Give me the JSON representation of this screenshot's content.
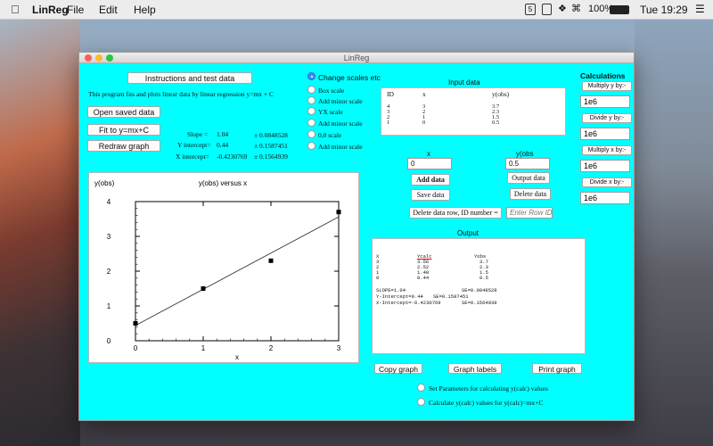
{
  "menubar": {
    "app_name": "LinReg",
    "menus": [
      "File",
      "Edit",
      "Help"
    ],
    "status": {
      "calendar": "5",
      "battery": "100%",
      "clock": "Tue 19:29"
    }
  },
  "window": {
    "title": "LinReg"
  },
  "left": {
    "instructions_button": "Instructions and test data",
    "description": "This program fits and plots linear data by linear regression y=mx + C",
    "open_button": "Open saved data",
    "fit_button": "Fit to y=mx+C",
    "redraw_button": "Redraw graph",
    "stats": {
      "slope_label": "Slope =",
      "slope_value": "1.04",
      "slope_se": "± 0.0848528",
      "yint_label": "Y intercept=",
      "yint_value": "0.44",
      "yint_se": "± 0.1587451",
      "xint_label": "X intercept=",
      "xint_value": "-0.4230769",
      "xint_se": "± 0.1564939"
    }
  },
  "scale_options": [
    {
      "label": "Change scales etc",
      "selected": true
    },
    {
      "label": "Box scale",
      "selected": false
    },
    {
      "label": "Add minor scale",
      "selected": false
    },
    {
      "label": "YX scale",
      "selected": false
    },
    {
      "label": "Add minor scale",
      "selected": false
    },
    {
      "label": "0,0 scale",
      "selected": false
    },
    {
      "label": "Add minor scale",
      "selected": false
    }
  ],
  "input": {
    "title": "Input data",
    "headers": [
      "ID",
      "x",
      "y(obs)"
    ],
    "rows": [
      [
        "4",
        "3",
        "3.7"
      ],
      [
        "3",
        "2",
        "2.3"
      ],
      [
        "2",
        "1",
        "1.5"
      ],
      [
        "1",
        "0",
        "0.5"
      ]
    ],
    "x_label": "x",
    "y_label": "y(obs",
    "x_value": "0",
    "y_value": "0.5",
    "add_button": "Add data",
    "output_data_button": "Output data",
    "save_button": "Save data",
    "delete_button": "Delete data",
    "delete_row_button": "Delete data row, ID number =",
    "row_id_placeholder": "Enter Row ID"
  },
  "output": {
    "title": "Output",
    "headers": [
      "X",
      "Ycalc",
      "Yobs"
    ],
    "rows": [
      [
        "3",
        "3.56",
        "3.7"
      ],
      [
        "2",
        "2.52",
        "2.3"
      ],
      [
        "1",
        "1.48",
        "1.5"
      ],
      [
        "0",
        "0.44",
        "0.5"
      ]
    ],
    "stats": [
      [
        "SLOPE=1.04",
        "SE=0.0848528"
      ],
      [
        "Y-Intercept=0.44",
        "SE=0.1587451"
      ],
      [
        "X-Intercept=-0.4230769",
        "SE=0.1564939"
      ]
    ],
    "copy_button": "Copy graph",
    "labels_button": "Graph labels",
    "print_button": "Print graph",
    "radio1": "Set Parameters for calculating y(calc) values",
    "radio2": "Calculate y(calc) values for y(calc)=mx+C"
  },
  "calculations": {
    "title": "Calculations",
    "items": [
      {
        "button": "Multiply y by:-",
        "value": "1e6"
      },
      {
        "button": "Divide y by:-",
        "value": "1e6"
      },
      {
        "button": "Multiply x by:-",
        "value": "1e6"
      },
      {
        "button": "Divide x by:-",
        "value": "1e6"
      }
    ]
  },
  "chart_data": {
    "type": "scatter",
    "title": "y(obs) versus x",
    "xlabel": "x",
    "ylabel": "y(obs)",
    "x": [
      0,
      1,
      2,
      3
    ],
    "y": [
      0.5,
      1.5,
      2.3,
      3.7
    ],
    "fit_line": {
      "slope": 1.04,
      "intercept": 0.44
    },
    "xlim": [
      0,
      3
    ],
    "ylim": [
      0,
      4
    ],
    "xticks": [
      0,
      1,
      2,
      3
    ],
    "yticks": [
      0,
      1,
      2,
      3,
      4
    ]
  }
}
